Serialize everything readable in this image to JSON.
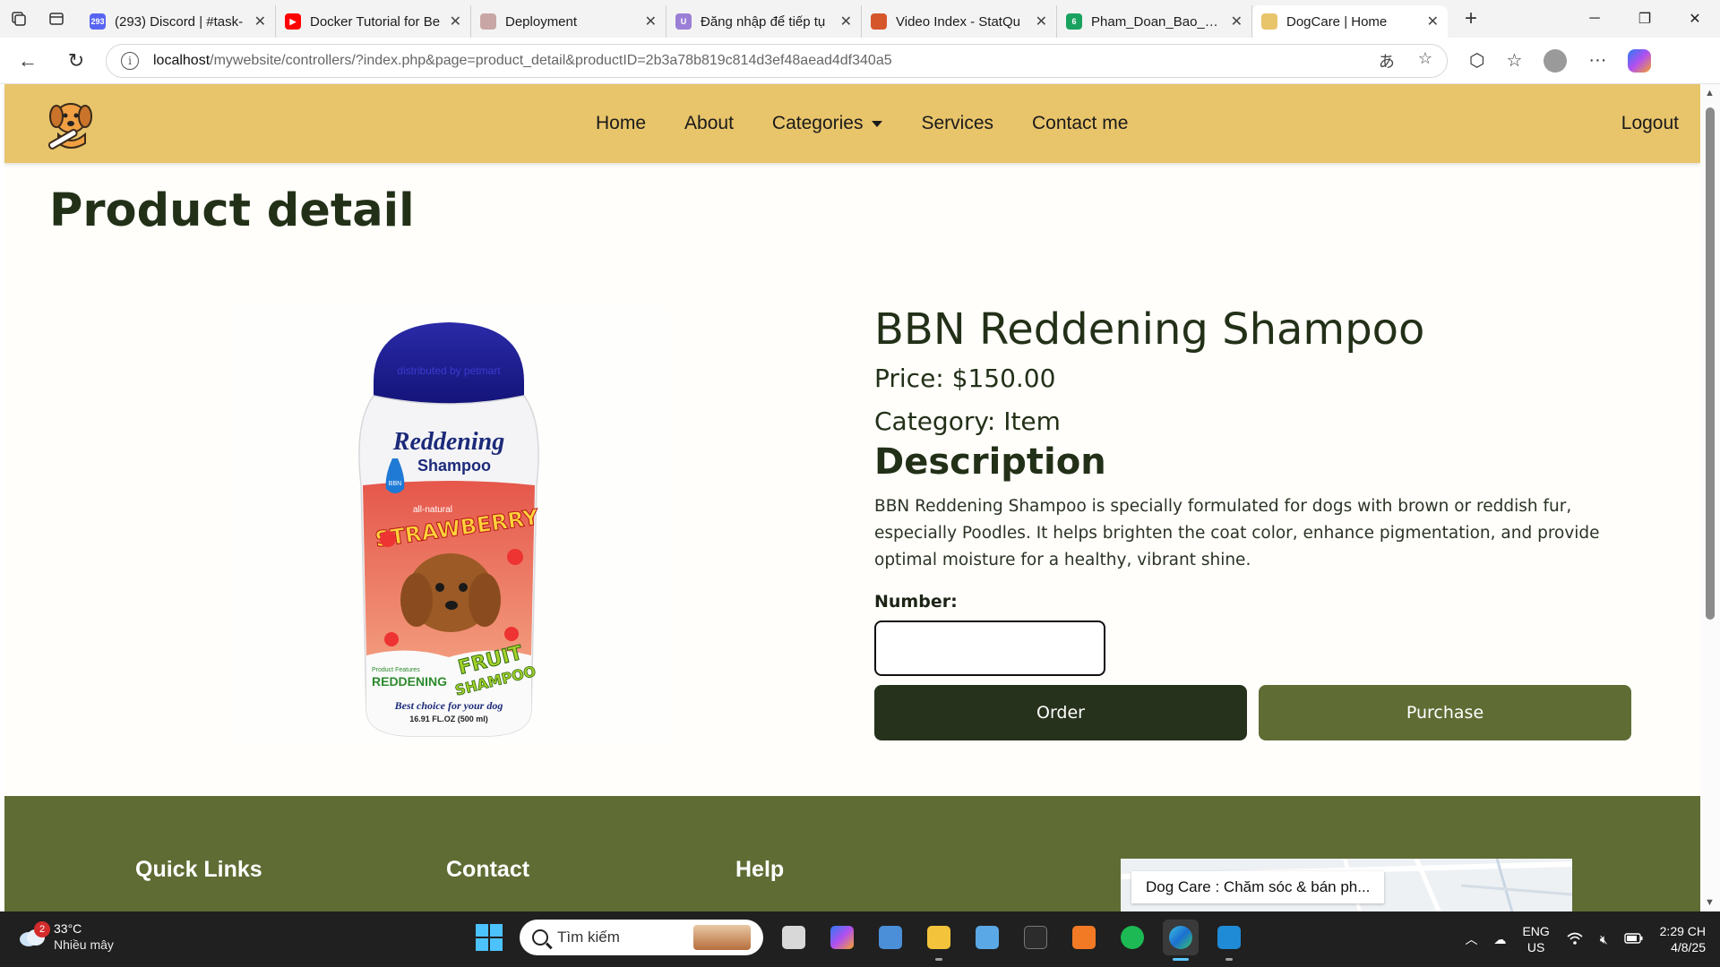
{
  "browser": {
    "tabs": [
      {
        "title": "(293) Discord | #task-",
        "favicon_color": "#5865f2",
        "favicon_text": "293"
      },
      {
        "title": "Docker Tutorial for Be",
        "favicon_color": "#ff0000",
        "favicon_text": "▶"
      },
      {
        "title": "Deployment",
        "favicon_color": "#c9a6a6",
        "favicon_text": ""
      },
      {
        "title": "Đăng nhập để tiếp tụ",
        "favicon_color": "#9b7fd6",
        "favicon_text": "U"
      },
      {
        "title": "Video Index - StatQu",
        "favicon_color": "#d6562b",
        "favicon_text": ""
      },
      {
        "title": "Pham_Doan_Bao_Trun",
        "favicon_color": "#1aa260",
        "favicon_text": "6"
      },
      {
        "title": "DogCare | Home",
        "favicon_color": "#e8c46b",
        "favicon_text": "",
        "active": true
      }
    ],
    "url_host": "localhost",
    "url_path": "/mywebsite/controllers/?index.php&page=product_detail&productID=2b3a78b819c814d3ef48aead4df340a5"
  },
  "site": {
    "nav": {
      "home": "Home",
      "about": "About",
      "categories": "Categories",
      "services": "Services",
      "contact": "Contact me",
      "logout": "Logout"
    },
    "page_title": "Product detail",
    "product": {
      "name": "BBN Reddening Shampoo",
      "price": "Price: $150.00",
      "category": "Category: Item",
      "description_heading": "Description",
      "description": "BBN Reddening Shampoo is specially formulated for dogs with brown or reddish fur, especially Poodles. It helps brighten the coat color, enhance pigmentation, and provide optimal moisture for a healthy, vibrant shine.",
      "number_label": "Number:",
      "number_value": "",
      "order_label": "Order",
      "purchase_label": "Purchase",
      "image_text": {
        "cap": "distributed by petmart",
        "brand_line1": "Reddening",
        "brand_line2": "Shampoo",
        "tag": "BBN",
        "natural": "all-natural",
        "flavor": "STRAWBERRY",
        "features": "Product Features",
        "feature_name": "REDDENING",
        "fruit": "FRUIT",
        "shampoo": "SHAMPOO",
        "slogan": "Best choice for your dog",
        "volume": "16.91 FL.OZ (500 ml)"
      }
    },
    "footer": {
      "quick_links": "Quick Links",
      "contact": "Contact",
      "help": "Help",
      "map_card": "Dog Care : Chăm sóc & bán ph..."
    }
  },
  "taskbar": {
    "weather_temp": "33°C",
    "weather_cond": "Nhiều mây",
    "weather_badge": "2",
    "search_placeholder": "Tìm kiếm",
    "lang_line1": "ENG",
    "lang_line2": "US",
    "time": "2:29 CH",
    "date": "4/8/25"
  }
}
